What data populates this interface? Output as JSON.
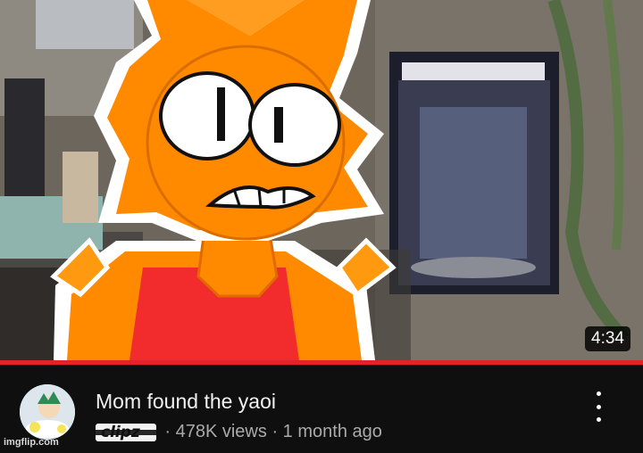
{
  "video": {
    "duration": "4:34",
    "title": "Mom found the yaoi",
    "channel": "clipz",
    "views": "478K views",
    "separator": "·",
    "uploaded": "1 month ago"
  },
  "progress": {
    "watched_fraction": 1.0,
    "color": "#e3222c"
  },
  "icons": {
    "menu": "more-vert-icon",
    "avatar": "channel-avatar"
  },
  "watermark": "imgflip.com",
  "colors": {
    "background": "#0f0f0f",
    "character_orange": "#ff8a00",
    "shirt_red": "#f22c2c"
  }
}
